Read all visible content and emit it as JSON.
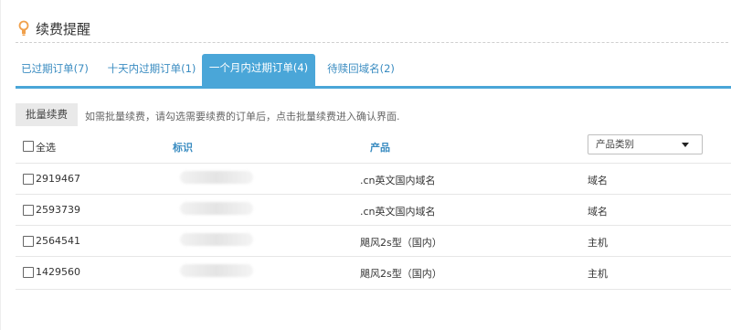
{
  "header": {
    "title": "续费提醒"
  },
  "tabs": [
    {
      "label": "已过期订单(7)",
      "active": false
    },
    {
      "label": "十天内过期订单(1)",
      "active": false
    },
    {
      "label": "一个月内过期订单(4)",
      "active": true
    },
    {
      "label": "待赎回域名(2)",
      "active": false
    }
  ],
  "toolbar": {
    "batch_renew_label": "批量续费",
    "hint": "如需批量续费，请勾选需要续费的订单后，点击批量续费进入确认界面."
  },
  "table": {
    "select_all_label": "全选",
    "columns": {
      "id": "标识",
      "product": "产品"
    },
    "product_type_filter": {
      "selected": "产品类别",
      "options": [
        "产品类别"
      ]
    },
    "rows": [
      {
        "order_id": "2919467",
        "product": ".cn英文国内域名",
        "type": "域名"
      },
      {
        "order_id": "2593739",
        "product": ".cn英文国内域名",
        "type": "域名"
      },
      {
        "order_id": "2564541",
        "product": "飓风2s型（国内）",
        "type": "主机"
      },
      {
        "order_id": "1429560",
        "product": "飓风2s型（国内）",
        "type": "主机"
      }
    ]
  },
  "colors": {
    "accent": "#4aa6d8",
    "link": "#3a8cc1",
    "icon": "#f0a04b"
  },
  "icons": {
    "title": "lightbulb-icon",
    "select": "caret-down-icon"
  }
}
